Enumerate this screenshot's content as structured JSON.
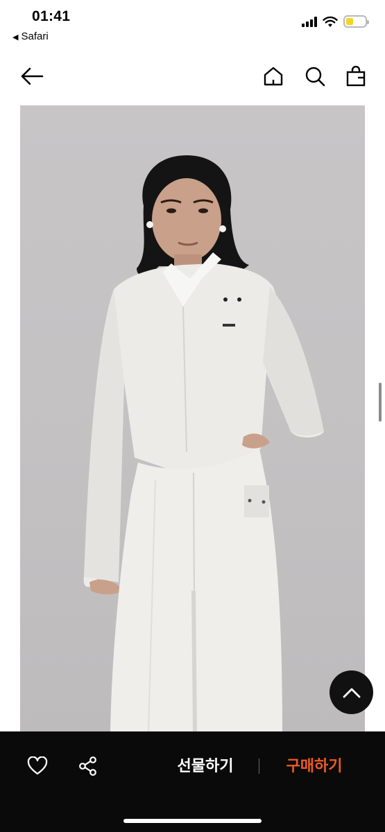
{
  "status_bar": {
    "time": "01:41",
    "back_app": "Safari",
    "back_glyph": "◀",
    "battery_color": "#f5d426"
  },
  "nav": {
    "back_icon": "arrow-left-icon",
    "home_icon": "home-icon",
    "search_icon": "search-icon",
    "bag_icon": "shopping-bag-icon"
  },
  "product": {
    "image_semantic": "model-in-white-cropped-jacket-and-pants"
  },
  "scroll_top": {
    "icon": "chevron-up-icon"
  },
  "bottom_bar": {
    "like_icon": "heart-icon",
    "share_icon": "share-icon",
    "gift_label": "선물하기",
    "buy_label": "구매하기",
    "buy_color": "#f05a22",
    "background": "#0a0a0a"
  }
}
